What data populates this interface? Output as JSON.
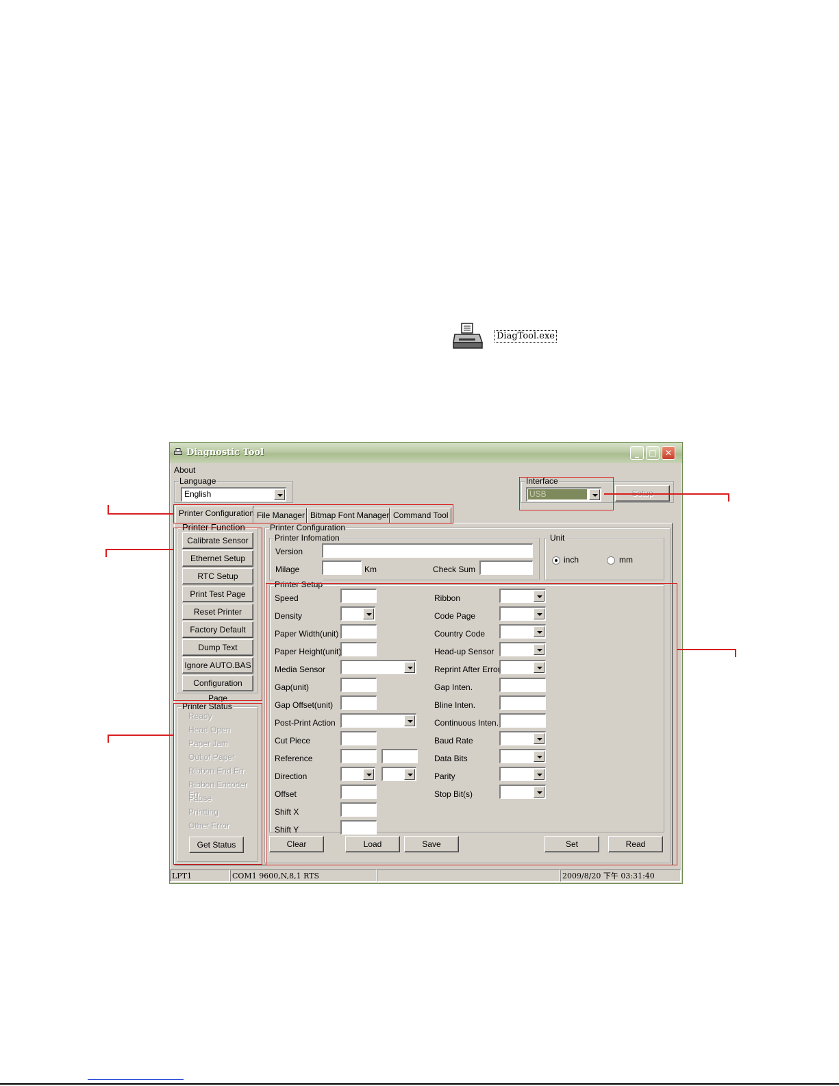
{
  "desktop_icon": {
    "label": "DiagTool.exe"
  },
  "window": {
    "title": "Diagnostic Tool",
    "menu": {
      "about": "About"
    },
    "language": {
      "group_label": "Language",
      "value": "English"
    },
    "interface": {
      "group_label": "Interface",
      "value": "USB",
      "setup_label": "Setup"
    },
    "tabs": [
      {
        "label": "Printer Configuration",
        "active": true
      },
      {
        "label": "File Manager"
      },
      {
        "label": "Bitmap Font Manager"
      },
      {
        "label": "Command Tool"
      }
    ],
    "printer_function": {
      "group_label": "Printer Function",
      "buttons": [
        "Calibrate Sensor",
        "Ethernet Setup",
        "RTC Setup",
        "Print Test Page",
        "Reset Printer",
        "Factory Default",
        "Dump Text",
        "Ignore AUTO.BAS",
        "Configuration Page"
      ]
    },
    "printer_status": {
      "group_label": "Printer Status",
      "items": [
        "Ready",
        "Head Open",
        "Paper Jam",
        "Out of Paper",
        "Ribbon End Err.",
        "Ribbon Encoder Err.",
        "Pause",
        "Printting",
        "Other Error"
      ],
      "get_status_label": "Get Status"
    },
    "printer_configuration": {
      "group_label": "Printer Configuration",
      "info": {
        "group_label": "Printer Infomation",
        "version_label": "Version",
        "milage_label": "Milage",
        "km_label": "Km",
        "checksum_label": "Check Sum"
      },
      "unit": {
        "group_label": "Unit",
        "inch_label": "inch",
        "mm_label": "mm",
        "selected": "inch"
      },
      "setup": {
        "group_label": "Printer Setup",
        "left": [
          "Speed",
          "Density",
          "Paper Width(unit)",
          "Paper Height(unit)",
          "Media Sensor",
          "Gap(unit)",
          "Gap Offset(unit)",
          "Post-Print Action",
          "Cut Piece",
          "Reference",
          "Direction",
          "Offset",
          "Shift X",
          "Shift Y"
        ],
        "right": [
          "Ribbon",
          "Code Page",
          "Country Code",
          "Head-up Sensor",
          "Reprint After Error",
          "Gap Inten.",
          "Bline Inten.",
          "Continuous Inten.",
          "Baud Rate",
          "Data Bits",
          "Parity",
          "Stop Bit(s)"
        ]
      },
      "buttons": {
        "clear": "Clear",
        "load": "Load",
        "save": "Save",
        "set": "Set",
        "read": "Read"
      }
    },
    "statusbar": {
      "port1": "LPT1",
      "port2": "COM1 9600,N,8,1 RTS",
      "blank": "",
      "datetime": "2009/8/20 下午 03:31:40"
    }
  },
  "colors": {
    "annotation": "#d81e1e",
    "window_face": "#d4d0c8",
    "interface_highlight": "#7f8a5c"
  }
}
